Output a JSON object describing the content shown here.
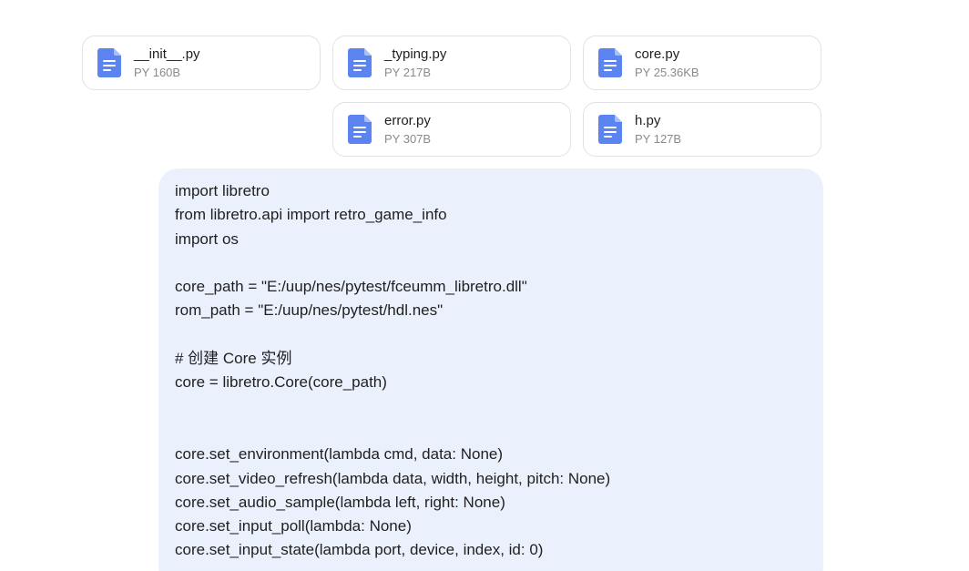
{
  "files": [
    {
      "name": "__init__.py",
      "info": "PY 160B",
      "icon": "document-icon"
    },
    {
      "name": "_typing.py",
      "info": "PY 217B",
      "icon": "document-icon"
    },
    {
      "name": "core.py",
      "info": "PY 25.36KB",
      "icon": "document-icon"
    },
    {
      "name": "error.py",
      "info": "PY 307B",
      "icon": "document-icon"
    },
    {
      "name": "h.py",
      "info": "PY 127B",
      "icon": "document-icon"
    }
  ],
  "message": {
    "lines": [
      "import libretro",
      "from libretro.api import retro_game_info",
      "import os",
      "",
      "core_path = \"E:/uup/nes/pytest/fceumm_libretro.dll\"",
      "rom_path = \"E:/uup/nes/pytest/hdl.nes\"",
      "",
      "# 创建 Core 实例",
      "core = libretro.Core(core_path)",
      "",
      "",
      "core.set_environment(lambda cmd, data: None)",
      "core.set_video_refresh(lambda data, width, height, pitch: None)",
      "core.set_audio_sample(lambda left, right: None)",
      "core.set_input_poll(lambda: None)",
      "core.set_input_state(lambda port, device, index, id: 0)"
    ]
  },
  "colors": {
    "icon_blue": "#5b84f0",
    "bubble_bg": "#ebf1fc",
    "card_border": "#e2e2e2",
    "muted_text": "#8a8a8a"
  }
}
